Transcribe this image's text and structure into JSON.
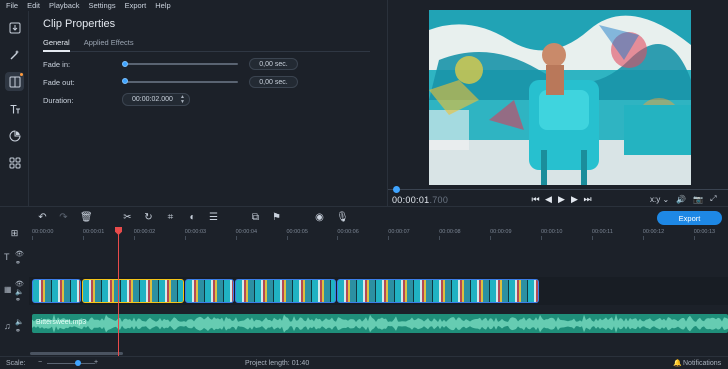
{
  "menu": [
    "File",
    "Edit",
    "Playback",
    "Settings",
    "Export",
    "Help"
  ],
  "sidebar": {
    "items": [
      {
        "name": "import-icon"
      },
      {
        "name": "magic-wand-icon"
      },
      {
        "name": "transitions-icon"
      },
      {
        "name": "titles-icon"
      },
      {
        "name": "stickers-icon"
      },
      {
        "name": "more-tools-icon"
      }
    ]
  },
  "props": {
    "title": "Clip Properties",
    "tabs": [
      "General",
      "Applied Effects"
    ],
    "fade_in_label": "Fade in:",
    "fade_in_value": "0,00 sec.",
    "fade_out_label": "Fade out:",
    "fade_out_value": "0,00 sec.",
    "duration_label": "Duration:",
    "duration_value": "00:00:02.000"
  },
  "preview": {
    "timecode_main": "00:00:01",
    "timecode_ms": ".700",
    "aspect": "x:y"
  },
  "toolbar": {
    "export_label": "Export"
  },
  "ruler": {
    "labels": [
      "00:00:00",
      "00:00:01",
      "00:00:02",
      "00:00:03",
      "00:00:04",
      "00:00:05",
      "00:00:06",
      "00:00:07",
      "00:00:08",
      "00:00:09",
      "00:00:10",
      "00:00:11",
      "00:00:12",
      "00:00:13"
    ]
  },
  "audio": {
    "label": "Bittersweet.mp3"
  },
  "status": {
    "scale_label": "Scale:",
    "project_length": "Project length:  01:40",
    "notifications": "Notifications"
  },
  "colors": {
    "accent": "#1e88e5",
    "playhead": "#e84b4b",
    "selected_clip": "#f5c518",
    "audio": "#1f8f7a"
  }
}
